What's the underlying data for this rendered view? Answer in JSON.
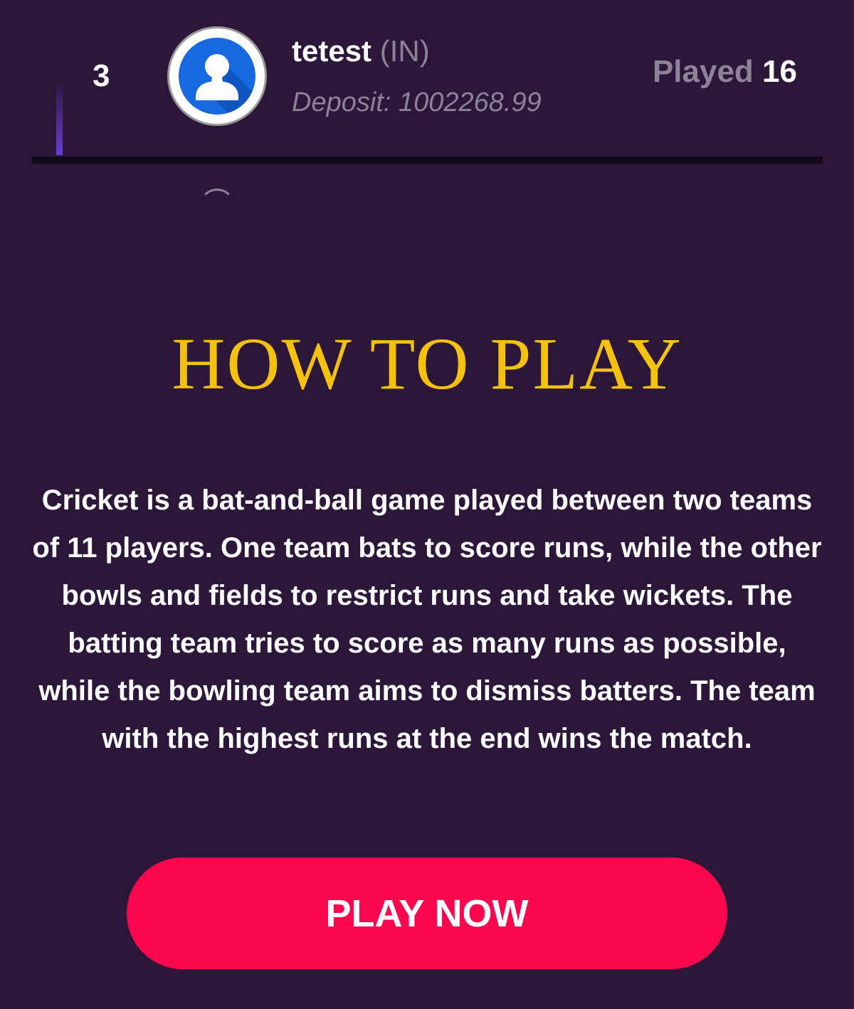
{
  "leaderboard_row": {
    "rank": "3",
    "name": "tetest",
    "country": "(IN)",
    "deposit_label": "Deposit:",
    "deposit_value": "1002268.99",
    "played_label": "Played",
    "played_count": "16",
    "avatar_icon": "user-avatar-icon"
  },
  "how_to_play": {
    "title": "HOW TO PLAY",
    "description": "Cricket is a bat-and-ball game played between two teams of 11 players. One team bats to score runs, while the other bowls and fields to restrict runs and take wickets. The batting team tries to score as many runs as possible, while the bowling team aims to dismiss batters. The team with the highest runs at the end wins the match."
  },
  "play_button": {
    "label": "PLAY NOW"
  },
  "colors": {
    "background": "#2c1639",
    "title": "#f4c20d",
    "button": "#fd0650",
    "muted_text": "#8d8298",
    "avatar_blue": "#1769e0"
  }
}
